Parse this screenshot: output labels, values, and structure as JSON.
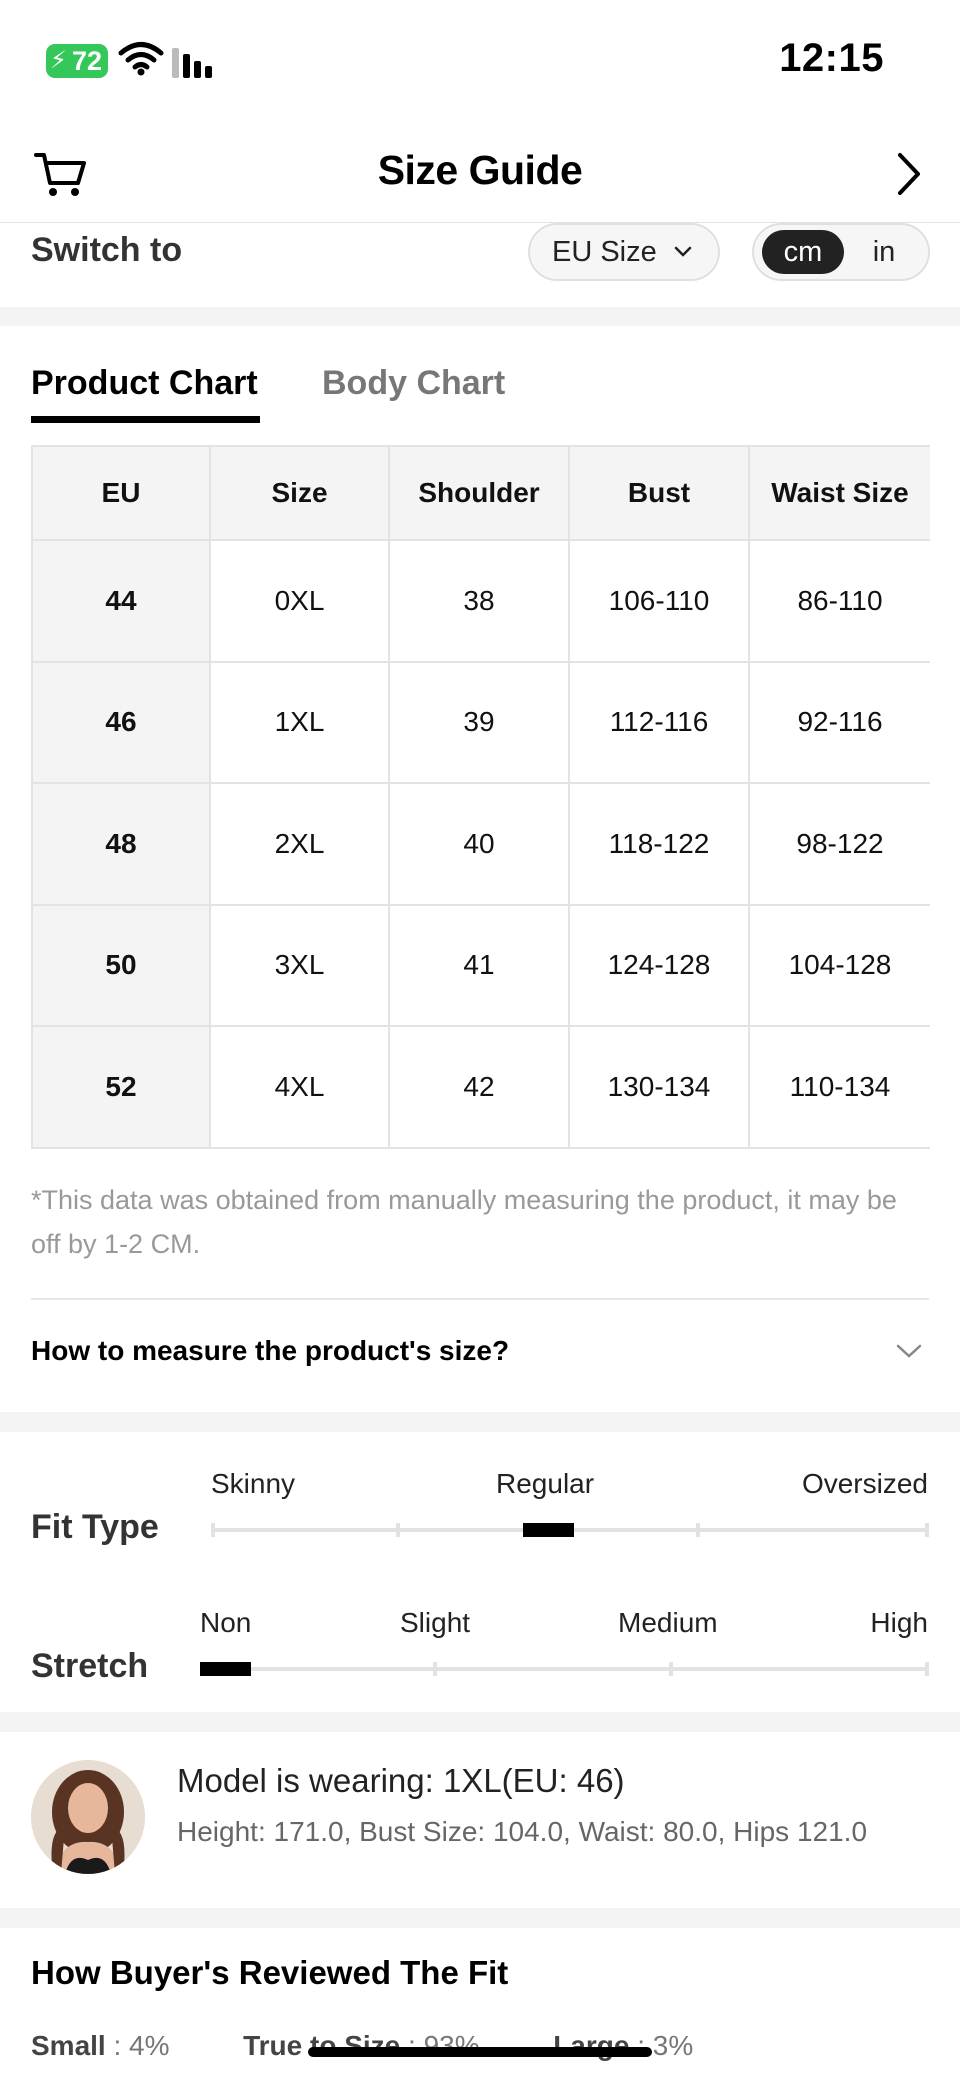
{
  "status_bar": {
    "battery": "72",
    "time": "12:15"
  },
  "header": {
    "title": "Size Guide"
  },
  "switch": {
    "label": "Switch to",
    "size_system": "EU Size",
    "units": [
      "cm",
      "in"
    ],
    "selected_unit": "cm"
  },
  "tabs": [
    {
      "label": "Product Chart",
      "active": true
    },
    {
      "label": "Body Chart",
      "active": false
    }
  ],
  "table": {
    "headers": [
      "EU",
      "Size",
      "Shoulder",
      "Bust",
      "Waist Size"
    ],
    "rows": [
      [
        "44",
        "0XL",
        "38",
        "106-110",
        "86-110"
      ],
      [
        "46",
        "1XL",
        "39",
        "112-116",
        "92-116"
      ],
      [
        "48",
        "2XL",
        "40",
        "118-122",
        "98-122"
      ],
      [
        "50",
        "3XL",
        "41",
        "124-128",
        "104-128"
      ],
      [
        "52",
        "4XL",
        "42",
        "130-134",
        "110-134"
      ]
    ]
  },
  "note": "*This data was obtained from manually measuring the product, it may be off by 1-2 CM.",
  "measure_question": "How to measure the product's size?",
  "fit_type": {
    "title": "Fit Type",
    "labels": [
      "Skinny",
      "Regular",
      "Oversized"
    ],
    "selected": "Regular"
  },
  "stretch": {
    "title": "Stretch",
    "labels": [
      "Non",
      "Slight",
      "Medium",
      "High"
    ],
    "selected": "Non"
  },
  "model": {
    "wearing": "Model is wearing: 1XL(EU: 46)",
    "details": "Height: 171.0,  Bust Size: 104.0,  Waist: 80.0,  Hips 121.0"
  },
  "reviews": {
    "title": "How Buyer's Reviewed The Fit",
    "items": [
      {
        "label": "Small",
        "value": ": 4%"
      },
      {
        "label": "True to Size",
        "value": ": 93%"
      },
      {
        "label": "Large",
        "value": ": 3%"
      }
    ]
  },
  "colors": {
    "accent": "#000000",
    "battery": "#34c759",
    "muted": "#999999"
  }
}
